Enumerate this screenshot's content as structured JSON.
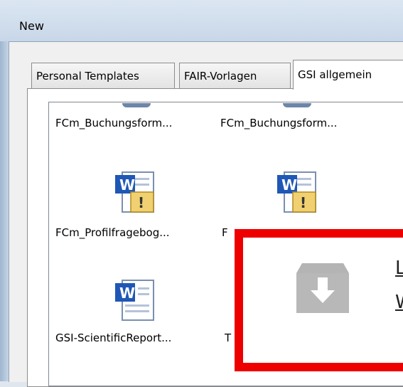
{
  "window": {
    "title": "New"
  },
  "tabs": [
    {
      "label": "Personal Templates"
    },
    {
      "label": "FAIR-Vorlagen"
    },
    {
      "label": "GSI allgemein"
    }
  ],
  "items": [
    {
      "label": "FCm_Buchungsform..."
    },
    {
      "label": "FCm_Buchungsform..."
    },
    {
      "label": "FCm_Profilfragebog..."
    },
    {
      "label": "F"
    },
    {
      "label": "GSI-ScientificReport..."
    },
    {
      "label": "T"
    }
  ],
  "overlay": {
    "link_line1": "L",
    "link_line2": "W"
  },
  "colors": {
    "overlay_border": "#ee0000",
    "download_icon": "#b4b4b4",
    "word_blue": "#1f57b5"
  }
}
